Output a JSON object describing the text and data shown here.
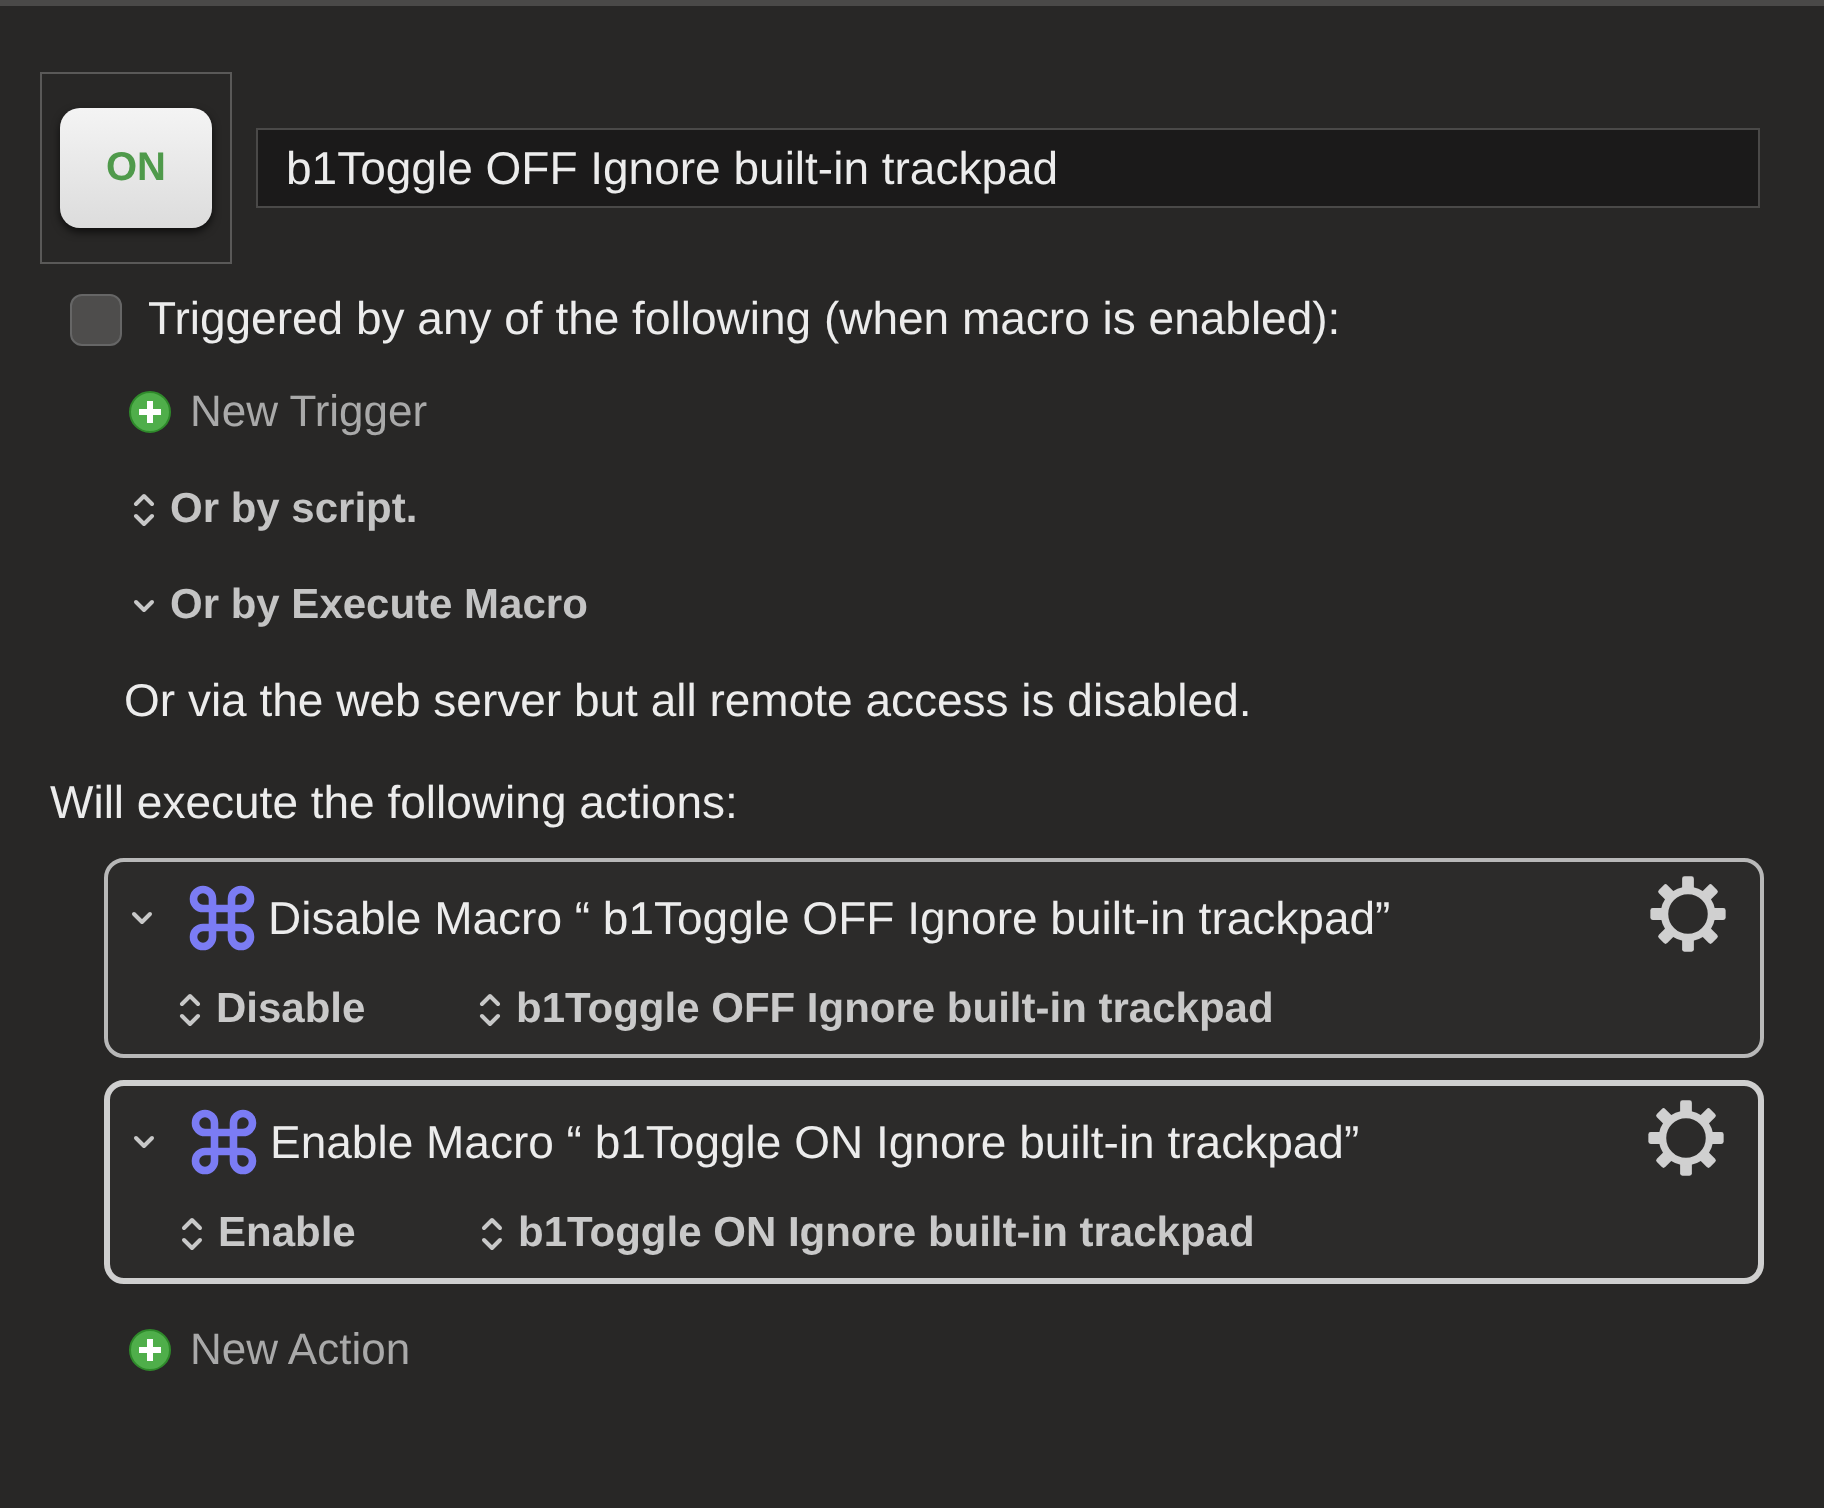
{
  "macro": {
    "icon_label": "ON",
    "name": "b1Toggle OFF Ignore built-in trackpad"
  },
  "trigger": {
    "checked": false,
    "label": "Triggered by any of the following (when macro is enabled):"
  },
  "new_trigger": "New Trigger",
  "options": [
    {
      "kind": "stepper",
      "label": "Or by script."
    },
    {
      "kind": "chevron",
      "label": "Or by Execute Macro"
    }
  ],
  "web_server_note": "Or via the web server but all remote access is disabled.",
  "actions_heading": "Will execute the following actions:",
  "actions": [
    {
      "title": "Disable Macro “ b1Toggle OFF Ignore built-in trackpad”",
      "selected": false,
      "expanded": true,
      "fields": [
        "Disable",
        "b1Toggle OFF Ignore built-in trackpad"
      ]
    },
    {
      "title": "Enable Macro “ b1Toggle ON Ignore built-in trackpad”",
      "selected": true,
      "expanded": true,
      "fields": [
        "Enable",
        "b1Toggle ON Ignore built-in trackpad"
      ]
    }
  ],
  "new_action": "New Action"
}
